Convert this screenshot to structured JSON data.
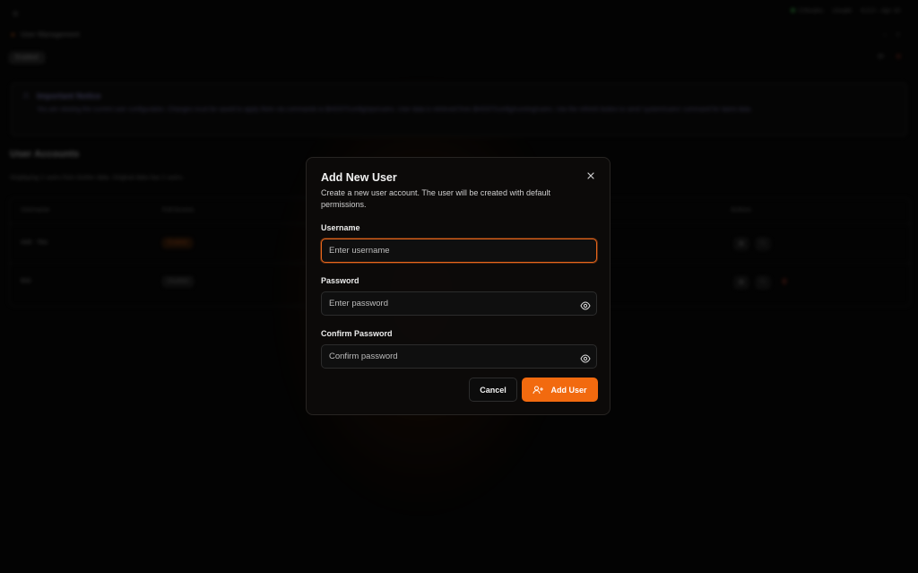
{
  "background": {
    "breadcrumb": "User Management",
    "tab_label": "Enabled",
    "status": [
      "3 Routes",
      "Unsafe",
      "6.0.0 – Apr 18"
    ],
    "notice": {
      "title": "Important Notice",
      "text": "You are viewing the current user configuration. Changes must be saved to apply them via commands to $HOST/config/ops/users. User data is retrieved from $HOST/config/running/users. Use the refresh button to send 'system/users' command for latest data."
    },
    "section_title": "User Accounts",
    "section_subtitle": "Displaying 2 users from broker data. Original data has 2 users.",
    "table": {
      "headers": [
        "Username",
        "Full Access",
        "Actions"
      ],
      "rows": [
        {
          "username": "root · You",
          "access": "Enabled"
        },
        {
          "username": "test",
          "access": "Disabled"
        }
      ]
    }
  },
  "modal": {
    "title": "Add New User",
    "description": "Create a new user account. The user will be created with default permissions.",
    "close_icon": "close-icon",
    "fields": {
      "username": {
        "label": "Username",
        "placeholder": "Enter username",
        "value": ""
      },
      "password": {
        "label": "Password",
        "placeholder": "Enter password",
        "value": ""
      },
      "confirm_password": {
        "label": "Confirm Password",
        "placeholder": "Confirm password",
        "value": ""
      }
    },
    "buttons": {
      "cancel": "Cancel",
      "add": "Add User"
    }
  },
  "colors": {
    "accent": "#f26a0f",
    "modal_bg": "#0c0a09",
    "page_bg": "#050505"
  }
}
